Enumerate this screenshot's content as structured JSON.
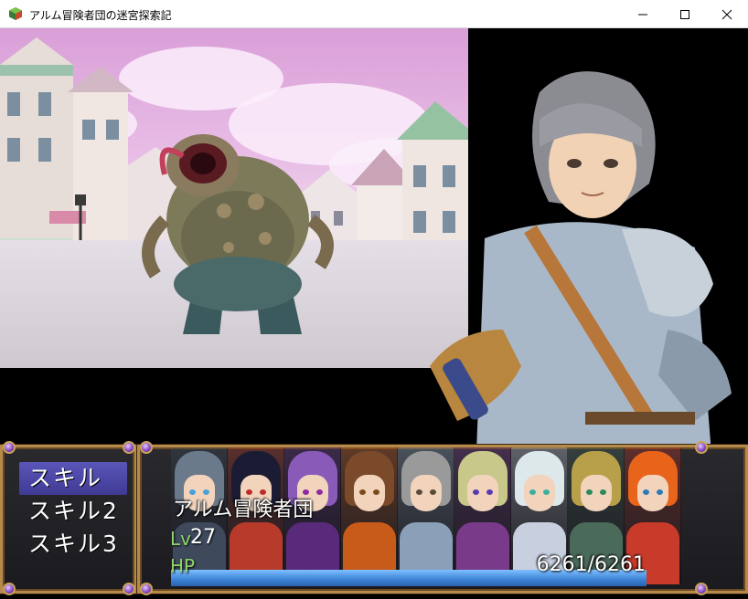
{
  "window": {
    "title": "アルム冒険者団の迷宮探索記",
    "minimize_icon": "minimize-icon",
    "maximize_icon": "maximize-icon",
    "close_icon": "close-icon"
  },
  "menu": {
    "items": [
      {
        "label": "スキル",
        "selected": true
      },
      {
        "label": "スキル2",
        "selected": false
      },
      {
        "label": "スキル3",
        "selected": false
      }
    ]
  },
  "party": {
    "name": "アルム冒険者団",
    "level_label": "Lv",
    "level": "27",
    "hp_label": "HP",
    "hp_text": "6261/6261",
    "hp_fraction": 1.0,
    "members": [
      {
        "hair": "#6b7a8a",
        "outfit": "#3e4a5c",
        "eye": "#4aa0d8"
      },
      {
        "hair": "#1b1c33",
        "outfit": "#b83a2a",
        "eye": "#c02a2a"
      },
      {
        "hair": "#8a5ab8",
        "outfit": "#5a2a7a",
        "eye": "#8a2aa0"
      },
      {
        "hair": "#7a4a2a",
        "outfit": "#c85a1a",
        "eye": "#7a4a1a"
      },
      {
        "hair": "#9a9a9a",
        "outfit": "#8aa0b8",
        "eye": "#5a4a3a"
      },
      {
        "hair": "#c8c88a",
        "outfit": "#7a3a8a",
        "eye": "#5a3ab0"
      },
      {
        "hair": "#dde8ea",
        "outfit": "#c8d0e0",
        "eye": "#3ab0a0"
      },
      {
        "hair": "#b8a04a",
        "outfit": "#4a6a5a",
        "eye": "#2a8a5a"
      },
      {
        "hair": "#e8641a",
        "outfit": "#c83a2a",
        "eye": "#2a7ab8"
      }
    ]
  },
  "colors": {
    "menu_selected": "#4a46a8",
    "frame_gold": "#b58a4a",
    "level_green": "#8fd46a",
    "hp_bar": "#3b82d6"
  }
}
